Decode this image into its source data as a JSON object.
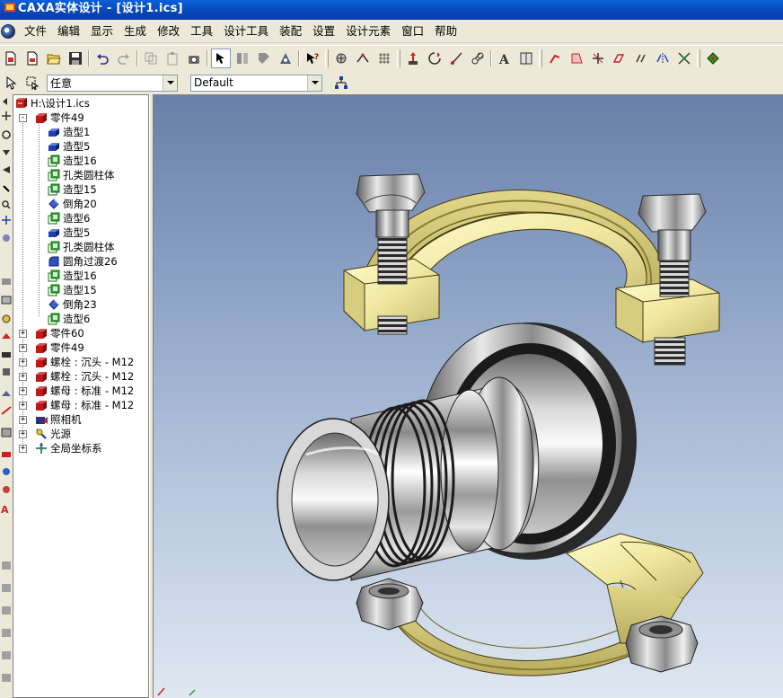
{
  "window": {
    "title": "CAXA实体设计 - [设计1.ics]"
  },
  "menu": [
    "文件",
    "编辑",
    "显示",
    "生成",
    "修改",
    "工具",
    "设计工具",
    "装配",
    "设置",
    "设计元素",
    "窗口",
    "帮助"
  ],
  "toolbar2": {
    "filter_value": "任意",
    "style_value": "Default"
  },
  "tree": {
    "root": "H:\\设计1.ics",
    "items": [
      {
        "label": "零件49",
        "icon": "part-icon",
        "expander": "-"
      },
      {
        "label": "造型1",
        "icon": "shape-icon"
      },
      {
        "label": "造型5",
        "icon": "shape-icon"
      },
      {
        "label": "造型16",
        "icon": "feature-green-icon"
      },
      {
        "label": "孔类圆柱体",
        "icon": "feature-green-icon"
      },
      {
        "label": "造型15",
        "icon": "feature-green-icon"
      },
      {
        "label": "倒角20",
        "icon": "chamfer-icon"
      },
      {
        "label": "造型6",
        "icon": "feature-green-icon"
      },
      {
        "label": "造型5",
        "icon": "shape-icon"
      },
      {
        "label": "孔类圆柱体",
        "icon": "feature-green-icon"
      },
      {
        "label": "圆角过渡26",
        "icon": "fillet-icon"
      },
      {
        "label": "造型16",
        "icon": "feature-green-icon"
      },
      {
        "label": "造型15",
        "icon": "feature-green-icon"
      },
      {
        "label": "倒角23",
        "icon": "chamfer-icon"
      },
      {
        "label": "造型6",
        "icon": "feature-green-icon"
      },
      {
        "label": "零件60",
        "icon": "part-icon",
        "expander": "+"
      },
      {
        "label": "零件49",
        "icon": "part-icon",
        "expander": "+"
      },
      {
        "label": "螺栓 : 沉头 - M12",
        "icon": "part-icon",
        "expander": "+"
      },
      {
        "label": "螺栓 : 沉头 - M12",
        "icon": "part-icon",
        "expander": "+"
      },
      {
        "label": "螺母 : 标准 - M12",
        "icon": "part-icon",
        "expander": "+"
      },
      {
        "label": "螺母 : 标准 - M12",
        "icon": "part-icon",
        "expander": "+"
      },
      {
        "label": "照相机",
        "icon": "camera-icon",
        "expander": "+"
      },
      {
        "label": "光源",
        "icon": "light-icon",
        "expander": "+"
      },
      {
        "label": "全局坐标系",
        "icon": "axis-icon",
        "expander": "+"
      }
    ]
  },
  "colors": {
    "titlebar": "#0a4fc8",
    "clamp_yellow": "#f0eaa8",
    "steel": "#c8c8c8"
  }
}
